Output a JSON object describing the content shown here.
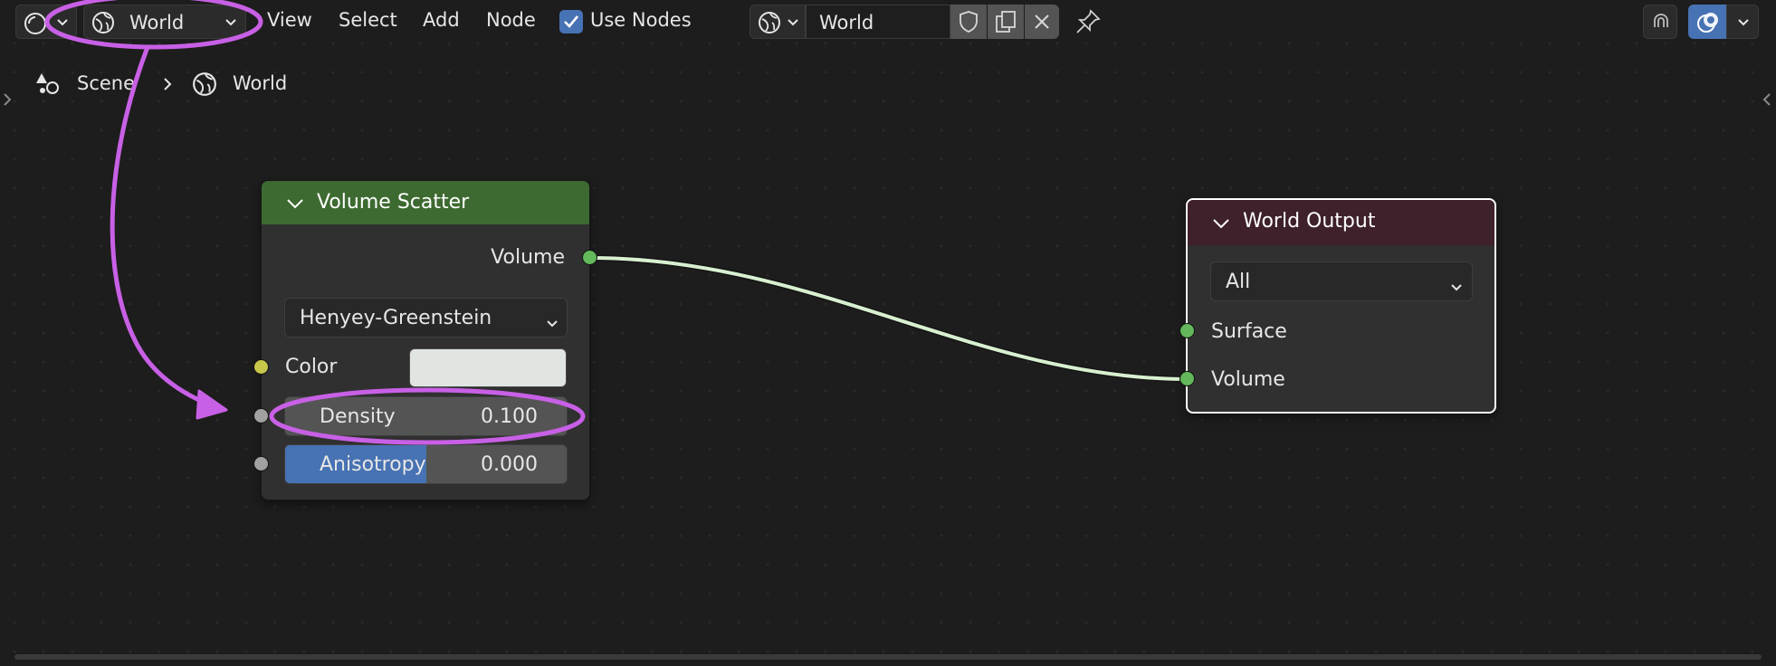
{
  "header": {
    "world_dropdown_label": "World",
    "menus": [
      "View",
      "Select",
      "Add",
      "Node"
    ],
    "use_nodes_label": "Use Nodes",
    "use_nodes_checked": true,
    "datablock_name": "World"
  },
  "breadcrumb": {
    "scene": "Scene",
    "world": "World"
  },
  "nodes": {
    "volume_scatter": {
      "title": "Volume Scatter",
      "header_color": "#3d6a30",
      "output_label": "Volume",
      "phase_dropdown": "Henyey-Greenstein",
      "color_label": "Color",
      "color_value": "#e1e5e2",
      "density_label": "Density",
      "density_value": "0.100",
      "anisotropy_label": "Anisotropy",
      "anisotropy_value": "0.000",
      "anisotropy_fill": 0.5
    },
    "world_output": {
      "title": "World Output",
      "header_color": "#3e212a",
      "target_dropdown": "All",
      "surface_label": "Surface",
      "volume_label": "Volume"
    }
  },
  "colors": {
    "annotation": "#c860e6",
    "link": "#d8f0d0",
    "socket_shader": "#62b85a",
    "socket_color": "#c7c74a",
    "socket_float": "#a1a1a1",
    "accent": "#4772b3"
  }
}
